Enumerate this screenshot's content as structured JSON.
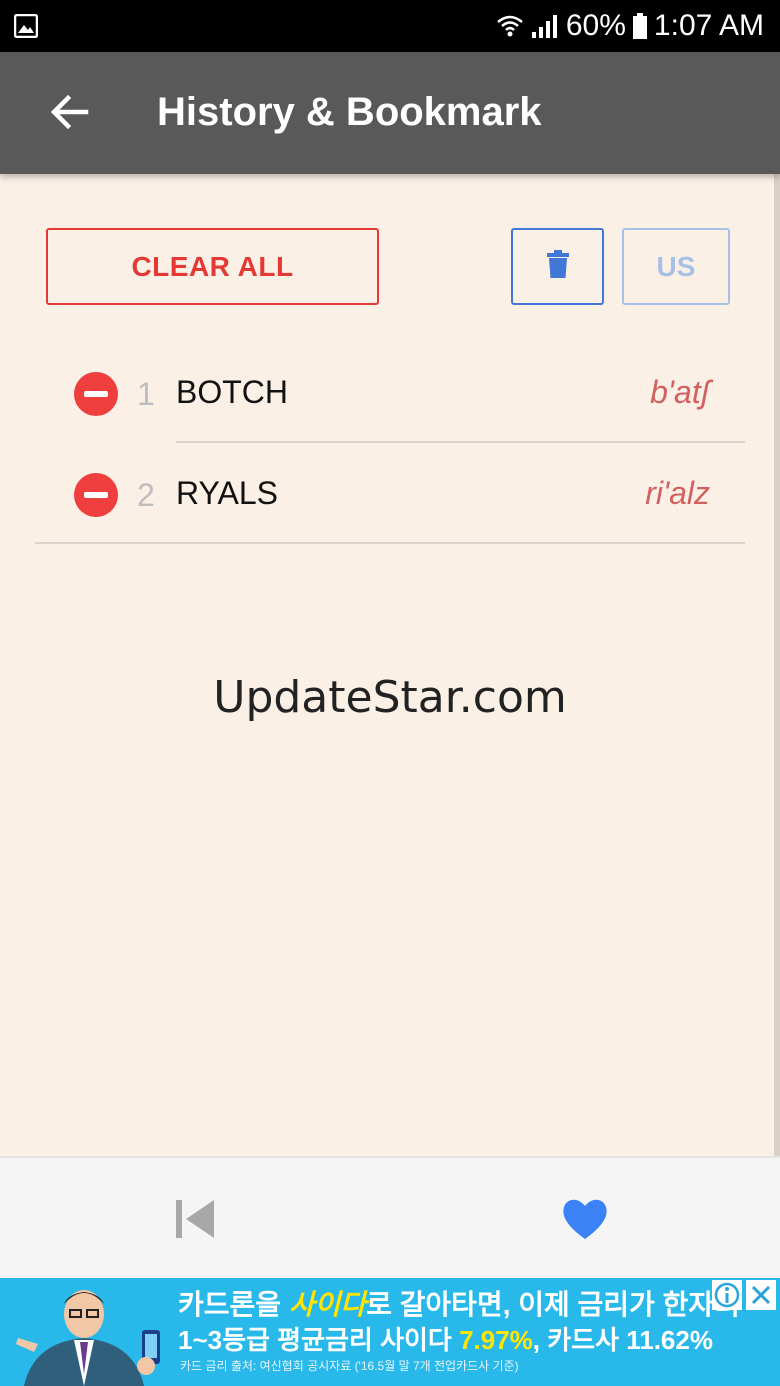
{
  "status_bar": {
    "battery": "60%",
    "time": "1:07 AM"
  },
  "app_bar": {
    "title": "History & Bookmark"
  },
  "toolbar": {
    "clear_all_label": "CLEAR ALL",
    "lang_label": "US"
  },
  "history": [
    {
      "index": "1",
      "word": "BOTCH",
      "phonetic": "b'atʃ"
    },
    {
      "index": "2",
      "word": "RYALS",
      "phonetic": "ri'alz"
    }
  ],
  "watermark": "UpdateStar.com",
  "ad": {
    "line1_part1": "카드론을 ",
    "line1_highlight": "사이다",
    "line1_part2": "로 갈아타면, 이제 금리가 한자리",
    "line2_part1": "1~3등급 평균금리 사이다 ",
    "line2_highlight": "7.97%",
    "line2_part2": ", 카드사 11.62%",
    "line3": "카드 금리 출처: 여신협회 공시자료 ('16.5월 말 7개 전업카드사 기준)"
  },
  "colors": {
    "app_bar": "#595959",
    "content_bg": "#faf0e6",
    "accent_red": "#e53935",
    "accent_blue": "#4178d8",
    "phonetic": "#d35f5f",
    "heart": "#3b82f6",
    "ad_bg": "#29b8ea"
  },
  "icons": {
    "back": "arrow-left-icon",
    "trash": "trash-icon",
    "remove": "minus-circle-icon",
    "prev": "skip-previous-icon",
    "favorite": "heart-icon",
    "info": "info-icon",
    "close": "close-icon"
  }
}
